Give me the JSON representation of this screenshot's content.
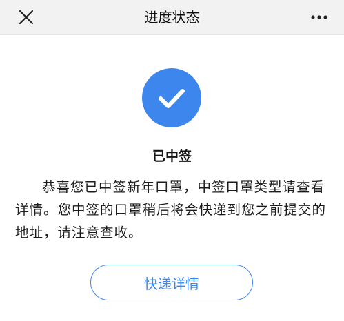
{
  "header": {
    "title": "进度状态",
    "close_icon": "close-icon",
    "more_icon": "more-options-icon"
  },
  "status": {
    "icon": "check-icon",
    "title": "已中签",
    "message": "恭喜您已中签新年口罩，中签口罩类型请查看详情。您中签的口罩稍后将会快递到您之前提交的地址，请注意查收。"
  },
  "actions": {
    "detail_label": "快递详情"
  },
  "colors": {
    "accent": "#3d86ee",
    "header_bg": "#f2f2f2"
  }
}
